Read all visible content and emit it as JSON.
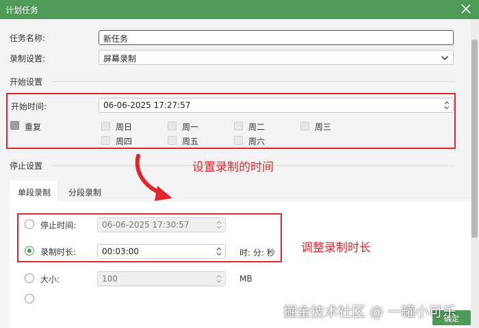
{
  "window": {
    "title": "计划任务"
  },
  "form": {
    "task_name_label": "任务名称:",
    "task_name_value": "新任务",
    "record_setting_label": "录制设置:",
    "record_setting_value": "屏幕录制"
  },
  "start": {
    "section_label": "开始设置",
    "time_label": "开始时间:",
    "time_value": "06-06-2025 17:27:57",
    "repeat_label": "重复",
    "days": [
      "周日",
      "周一",
      "周二",
      "周三",
      "周四",
      "周五",
      "周六"
    ]
  },
  "stop": {
    "section_label": "停止设置",
    "tabs": [
      "单段录制",
      "分段录制"
    ],
    "stop_time_label": "停止时间:",
    "stop_time_value": "06-06-2025 17:30:57",
    "duration_label": "录制时长:",
    "duration_value": "00:03:00",
    "duration_unit": "时: 分: 秒",
    "size_label": "大小:",
    "size_value": "100",
    "size_unit": "MB"
  },
  "annotations": {
    "set_time": "设置录制的时间",
    "adjust_duration": "调整录制时长"
  },
  "footer": {
    "ok_label": "确定"
  },
  "watermark": "掘金技术社区 @ 一罐小可乐",
  "colors": {
    "titlebar": "#4f9a57",
    "annotation": "#e0262c",
    "accent": "#4f9a57"
  }
}
